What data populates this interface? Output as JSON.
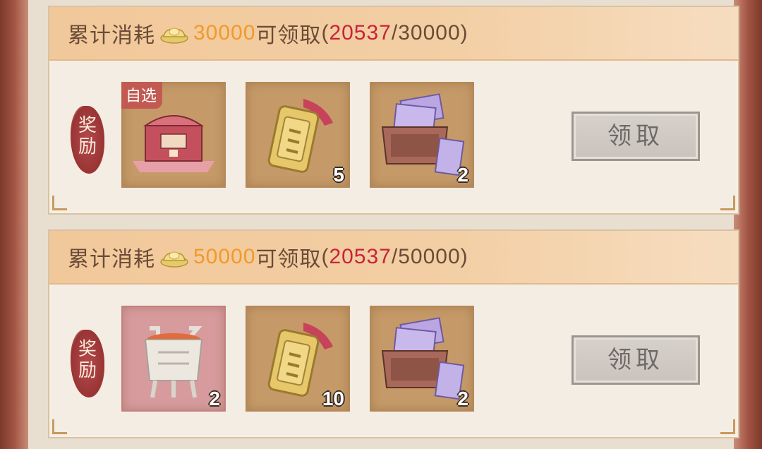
{
  "tiers": [
    {
      "label_prefix": "累计消耗",
      "amount": "30000",
      "label_suffix": "可领取",
      "progress_open": "(",
      "current": "20537",
      "sep": "/",
      "target": "30000",
      "progress_close": ")",
      "reward_label": "奖励",
      "items": [
        {
          "icon": "pink-treasure-chest-icon",
          "tag": "自选",
          "count": ""
        },
        {
          "icon": "golden-token-icon",
          "tag": "",
          "count": "5"
        },
        {
          "icon": "purple-notes-box-icon",
          "tag": "",
          "count": "2"
        }
      ],
      "claim_label": "领取"
    },
    {
      "label_prefix": "累计消耗",
      "amount": "50000",
      "label_suffix": "可领取",
      "progress_open": "(",
      "current": "20537",
      "sep": "/",
      "target": "50000",
      "progress_close": ")",
      "reward_label": "奖励",
      "items": [
        {
          "icon": "silver-tripod-icon",
          "tag": "",
          "count": "2"
        },
        {
          "icon": "golden-token-icon",
          "tag": "",
          "count": "10"
        },
        {
          "icon": "purple-notes-box-icon",
          "tag": "",
          "count": "2"
        }
      ],
      "claim_label": "领取"
    }
  ],
  "colors": {
    "amount": "#f09a2a",
    "current": "#c8233b",
    "header_bg": "#f3cfa5",
    "button_disabled": "#cfc9c2"
  }
}
